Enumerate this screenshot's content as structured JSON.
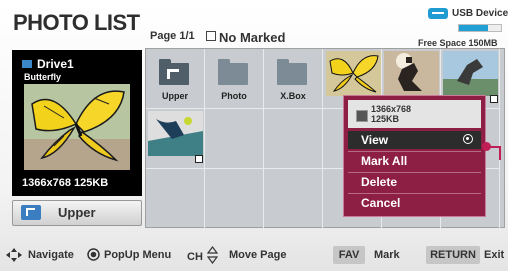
{
  "header": {
    "title": "PHOTO LIST",
    "page_info": "Page 1/1",
    "marked_status": "No Marked",
    "device": "USB Device",
    "free_space": "Free Space 150MB",
    "free_space_fraction": 0.7
  },
  "info_panel": {
    "drive": "Drive1",
    "file_name": "Butterfly",
    "resolution_size": "1366x768  125KB",
    "upper_label": "Upper"
  },
  "grid": {
    "folders": [
      {
        "label": "Upper",
        "icon": "up-folder-icon"
      },
      {
        "label": "Photo",
        "icon": "folder-icon"
      },
      {
        "label": "X.Box",
        "icon": "folder-icon"
      }
    ],
    "photos": [
      "butterfly",
      "rider",
      "jumper",
      "tennis"
    ]
  },
  "popup": {
    "resolution": "1366x768",
    "size": "125KB",
    "items": [
      "View",
      "Mark All",
      "Delete",
      "Cancel"
    ],
    "selected": "View"
  },
  "footer": {
    "navigate": "Navigate",
    "popup_menu": "PopUp Menu",
    "ch": "CH",
    "move_page": "Move Page",
    "fav_key": "FAV",
    "mark": "Mark",
    "return_key": "RETURN",
    "exit": "Exit"
  },
  "colors": {
    "accent": "#8e1f44",
    "selection": "#2c2c2c",
    "usb": "#1e9bd1"
  }
}
